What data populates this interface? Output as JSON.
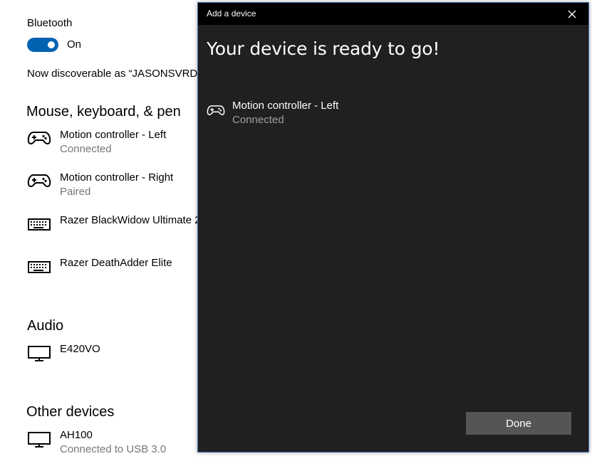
{
  "settings": {
    "bluetooth_label": "Bluetooth",
    "bluetooth_toggle_state": "On",
    "discoverable_text": "Now discoverable as “JASONSVRDES",
    "mouse_section_title": "Mouse, keyboard, & pen",
    "mouse_devices": [
      {
        "name": "Motion controller - Left",
        "status": "Connected",
        "icon": "gamepad-icon"
      },
      {
        "name": "Motion controller - Right",
        "status": "Paired",
        "icon": "gamepad-icon"
      },
      {
        "name": "Razer BlackWidow Ultimate 2",
        "status": "",
        "icon": "keyboard-icon"
      },
      {
        "name": "Razer DeathAdder Elite",
        "status": "",
        "icon": "keyboard-icon"
      }
    ],
    "audio_section_title": "Audio",
    "audio_devices": [
      {
        "name": "E420VO",
        "status": "",
        "icon": "monitor-icon"
      }
    ],
    "other_section_title": "Other devices",
    "other_devices": [
      {
        "name": "AH100",
        "status": "Connected to USB 3.0",
        "icon": "monitor-icon"
      }
    ]
  },
  "dialog": {
    "title": "Add a device",
    "headline": "Your device is ready to go!",
    "device": {
      "name": "Motion controller - Left",
      "status": "Connected",
      "icon": "gamepad-icon"
    },
    "done_label": "Done"
  },
  "colors": {
    "accent": "#0063b1",
    "dialog_bg": "#202020",
    "titlebar_bg": "#000000",
    "done_button_bg": "#555555",
    "secondary_text": "#767676"
  }
}
